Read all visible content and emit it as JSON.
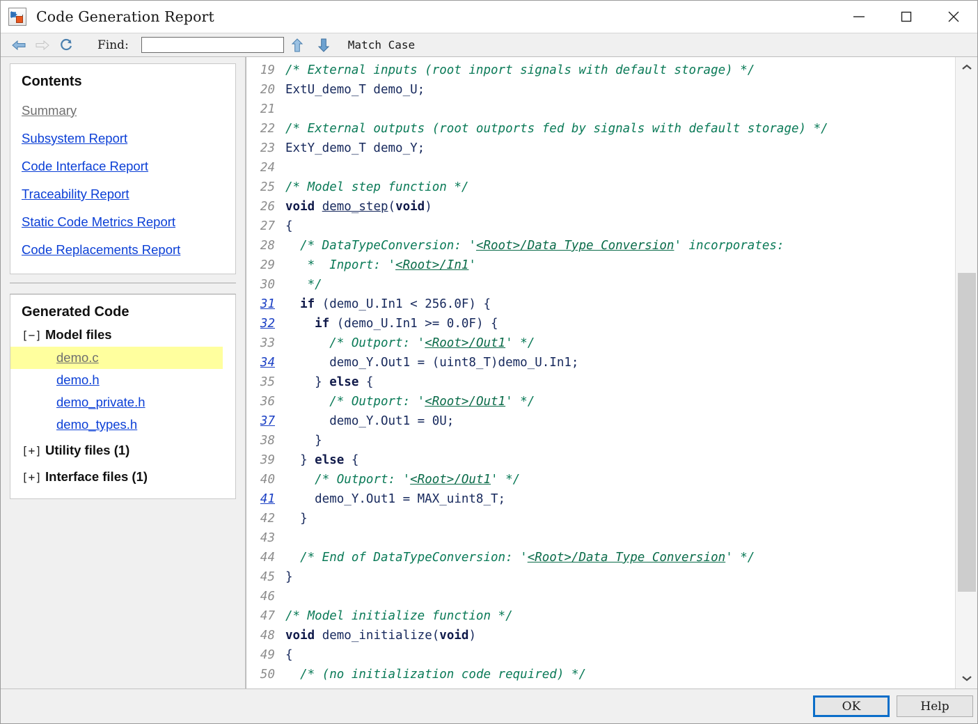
{
  "window": {
    "title": "Code Generation Report",
    "icon": "simulink-model-icon",
    "controls": {
      "minimize": "minimize-icon",
      "maximize": "maximize-icon",
      "close": "close-icon"
    }
  },
  "toolbar": {
    "back": "back-arrow-icon",
    "forward": "forward-arrow-icon",
    "refresh": "refresh-icon",
    "find_label": "Find:",
    "find_value": "",
    "find_placeholder": "",
    "find_next": "down-arrow-icon",
    "find_prev": "up-arrow-icon",
    "match_case_label": "Match Case"
  },
  "sidebar": {
    "contents": {
      "title": "Contents",
      "links": [
        {
          "label": "Summary",
          "state": "visited"
        },
        {
          "label": "Subsystem Report",
          "state": "link"
        },
        {
          "label": "Code Interface Report",
          "state": "link"
        },
        {
          "label": "Traceability Report",
          "state": "link"
        },
        {
          "label": "Static Code Metrics Report",
          "state": "link"
        },
        {
          "label": "Code Replacements Report",
          "state": "link"
        }
      ]
    },
    "generated_code": {
      "title": "Generated Code",
      "groups": [
        {
          "twisty": "[−]",
          "label": "Model files",
          "expanded": true,
          "files": [
            {
              "label": "demo.c",
              "selected": true
            },
            {
              "label": "demo.h",
              "selected": false
            },
            {
              "label": "demo_private.h",
              "selected": false
            },
            {
              "label": "demo_types.h",
              "selected": false
            }
          ]
        },
        {
          "twisty": "[+]",
          "label": "Utility files (1)",
          "expanded": false,
          "files": []
        },
        {
          "twisty": "[+]",
          "label": "Interface files (1)",
          "expanded": false,
          "files": []
        }
      ]
    }
  },
  "code": {
    "file": "demo.c",
    "first_line": 19,
    "last_line": 50,
    "lines": [
      {
        "n": "19",
        "anchor": false,
        "html": "<span class=\"cm\">/* External inputs (root inport signals with default storage) */</span>"
      },
      {
        "n": "20",
        "anchor": false,
        "html": "ExtU_demo_T demo_U;"
      },
      {
        "n": "21",
        "anchor": false,
        "html": ""
      },
      {
        "n": "22",
        "anchor": false,
        "html": "<span class=\"cm\">/* External outputs (root outports fed by signals with default storage) */</span>"
      },
      {
        "n": "23",
        "anchor": false,
        "html": "ExtY_demo_T demo_Y;"
      },
      {
        "n": "24",
        "anchor": false,
        "html": ""
      },
      {
        "n": "25",
        "anchor": false,
        "html": "<span class=\"cm\">/* Model step function */</span>"
      },
      {
        "n": "26",
        "anchor": false,
        "html": "<span class=\"kw\">void</span> <span class=\"fnlink\">demo_step</span>(<span class=\"kw\">void</span>)"
      },
      {
        "n": "27",
        "anchor": false,
        "html": "{"
      },
      {
        "n": "28",
        "anchor": false,
        "html": "  <span class=\"cm\">/* DataTypeConversion: '</span><span class=\"cmlink\">&lt;Root&gt;/Data Type Conversion</span><span class=\"cm\">' incorporates:</span>"
      },
      {
        "n": "29",
        "anchor": false,
        "html": "   <span class=\"cm\">*  Inport: '</span><span class=\"cmlink\">&lt;Root&gt;/In1</span><span class=\"cm\">'</span>"
      },
      {
        "n": "30",
        "anchor": false,
        "html": "   <span class=\"cm\">*/</span>"
      },
      {
        "n": "31",
        "anchor": true,
        "html": "  <span class=\"kw\">if</span> (demo_U.In1 &lt; 256.0F) {"
      },
      {
        "n": "32",
        "anchor": true,
        "html": "    <span class=\"kw\">if</span> (demo_U.In1 &gt;= 0.0F) {"
      },
      {
        "n": "33",
        "anchor": false,
        "html": "      <span class=\"cm\">/* Outport: '</span><span class=\"cmlink\">&lt;Root&gt;/Out1</span><span class=\"cm\">' */</span>"
      },
      {
        "n": "34",
        "anchor": true,
        "html": "      demo_Y.Out1 = (uint8_T)demo_U.In1;"
      },
      {
        "n": "35",
        "anchor": false,
        "html": "    } <span class=\"kw\">else</span> {"
      },
      {
        "n": "36",
        "anchor": false,
        "html": "      <span class=\"cm\">/* Outport: '</span><span class=\"cmlink\">&lt;Root&gt;/Out1</span><span class=\"cm\">' */</span>"
      },
      {
        "n": "37",
        "anchor": true,
        "html": "      demo_Y.Out1 = 0U;"
      },
      {
        "n": "38",
        "anchor": false,
        "html": "    }"
      },
      {
        "n": "39",
        "anchor": false,
        "html": "  } <span class=\"kw\">else</span> {"
      },
      {
        "n": "40",
        "anchor": false,
        "html": "    <span class=\"cm\">/* Outport: '</span><span class=\"cmlink\">&lt;Root&gt;/Out1</span><span class=\"cm\">' */</span>"
      },
      {
        "n": "41",
        "anchor": true,
        "html": "    demo_Y.Out1 = MAX_uint8_T;"
      },
      {
        "n": "42",
        "anchor": false,
        "html": "  }"
      },
      {
        "n": "43",
        "anchor": false,
        "html": ""
      },
      {
        "n": "44",
        "anchor": false,
        "html": "  <span class=\"cm\">/* End of DataTypeConversion: '</span><span class=\"cmlink\">&lt;Root&gt;/Data Type Conversion</span><span class=\"cm\">' */</span>"
      },
      {
        "n": "45",
        "anchor": false,
        "html": "}"
      },
      {
        "n": "46",
        "anchor": false,
        "html": ""
      },
      {
        "n": "47",
        "anchor": false,
        "html": "<span class=\"cm\">/* Model initialize function */</span>"
      },
      {
        "n": "48",
        "anchor": false,
        "html": "<span class=\"kw\">void</span> demo_initialize(<span class=\"kw\">void</span>)"
      },
      {
        "n": "49",
        "anchor": false,
        "html": "{"
      },
      {
        "n": "50",
        "anchor": false,
        "html": "  <span class=\"cm\">/* (no initialization code required) */</span>"
      }
    ]
  },
  "scrollbar": {
    "up": "scroll-up-icon",
    "down": "scroll-down-icon"
  },
  "footer": {
    "ok_label": "OK",
    "help_label": "Help"
  },
  "colors": {
    "link": "#0b3fd6",
    "visited": "#6f6f6f",
    "comment": "#0a7a57",
    "code": "#16285c",
    "selection": "#ffff9e",
    "focus": "#0b6ec9",
    "arrow": "#7ba7d7"
  }
}
